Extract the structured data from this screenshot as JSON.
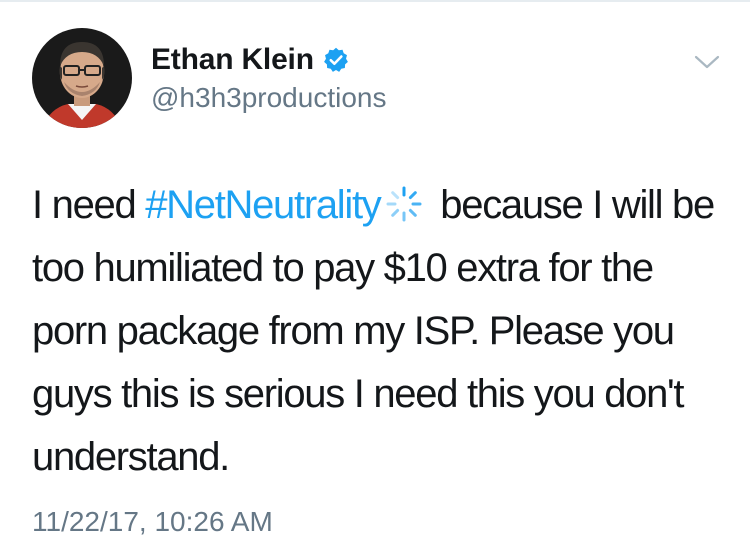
{
  "author": {
    "display_name": "Ethan Klein",
    "handle": "@h3h3productions",
    "verified": true,
    "avatar_icon": "profile-photo"
  },
  "tweet": {
    "text_before_hashtag": "I need ",
    "hashtag": "#NetNeutrality",
    "hashtag_emoji_icon": "spinner-icon",
    "text_after_hashtag": " because I will be too humiliated to pay $10 extra for the porn package from my ISP. Please you guys this is serious I need this you don't understand.",
    "timestamp": "11/22/17, 10:26 AM"
  },
  "colors": {
    "link_blue": "#1da1f2",
    "text_primary": "#14171a",
    "text_secondary": "#657786",
    "caret": "#aab8c2"
  }
}
